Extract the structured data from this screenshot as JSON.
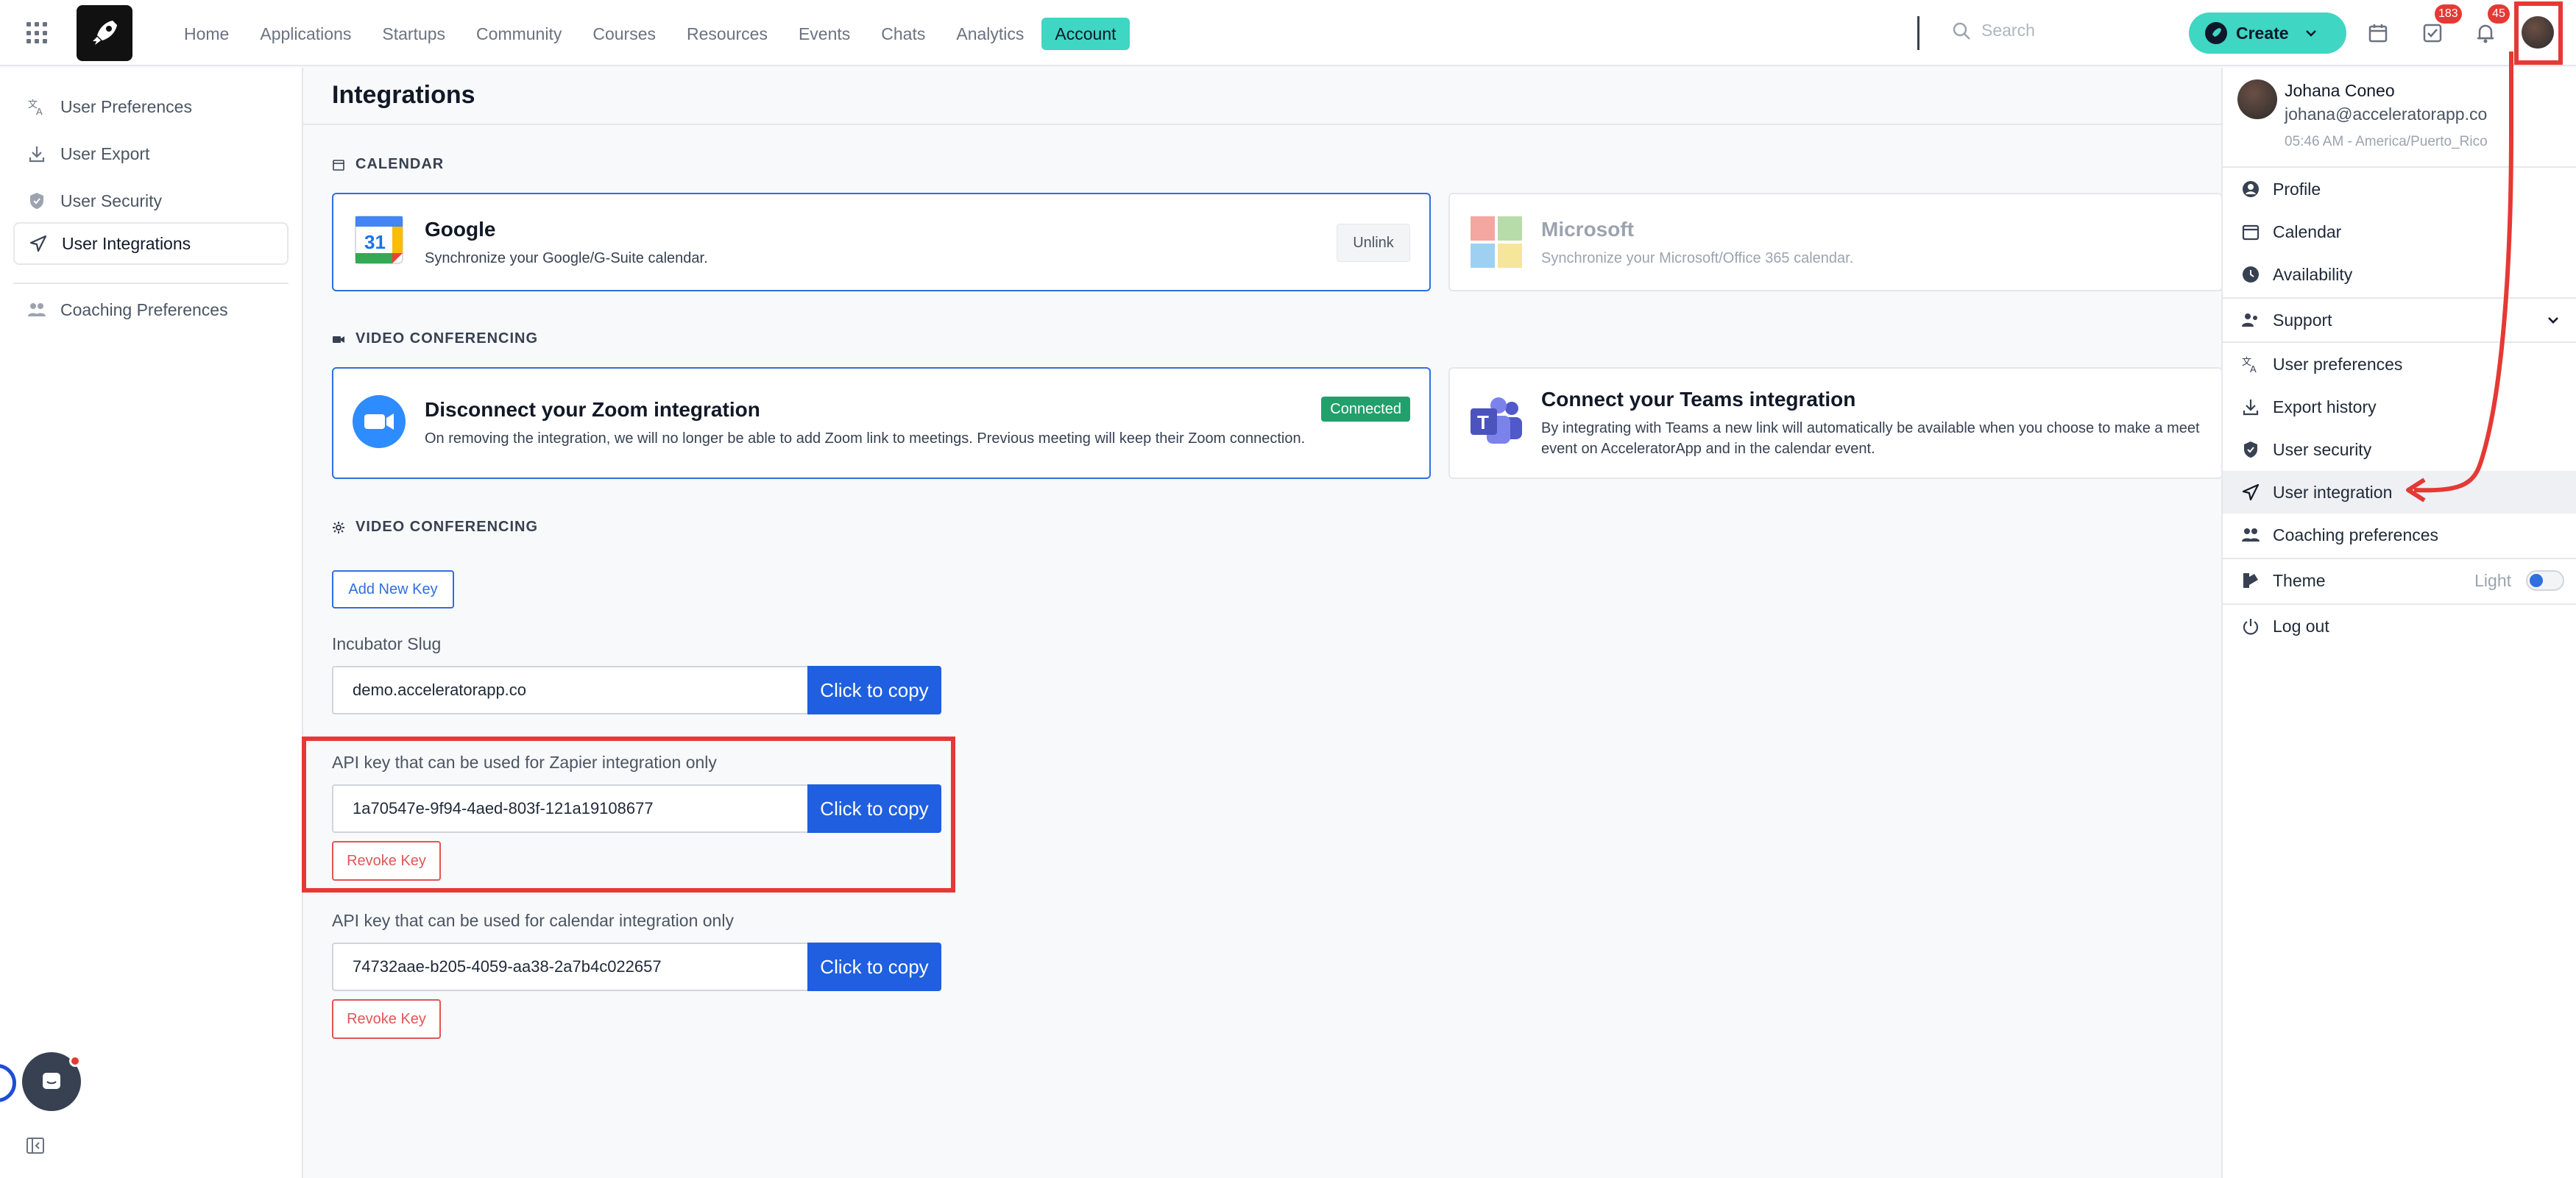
{
  "nav": {
    "items": [
      "Home",
      "Applications",
      "Startups",
      "Community",
      "Courses",
      "Resources",
      "Events",
      "Chats",
      "Analytics",
      "Account"
    ],
    "active": "Account",
    "search_placeholder": "Search",
    "create_label": "Create",
    "tasks_badge": "183",
    "notifications_badge": "45"
  },
  "sidebar": {
    "items": [
      {
        "label": "User Preferences",
        "icon": "translate-icon"
      },
      {
        "label": "User Export",
        "icon": "download-icon"
      },
      {
        "label": "User Security",
        "icon": "shield-icon"
      },
      {
        "label": "User Integrations",
        "icon": "send-icon"
      },
      {
        "label": "Coaching Preferences",
        "icon": "people-icon"
      }
    ]
  },
  "page": {
    "title": "Integrations",
    "calendar_section": "CALENDAR",
    "google": {
      "title": "Google",
      "desc": "Synchronize your Google/G-Suite calendar.",
      "action": "Unlink"
    },
    "microsoft": {
      "title": "Microsoft",
      "desc": "Synchronize your Microsoft/Office 365 calendar."
    },
    "video_section": "VIDEO CONFERENCING",
    "zoom": {
      "title": "Disconnect your Zoom integration",
      "desc": "On removing the integration, we will no longer be able to add Zoom link to meetings. Previous meeting will keep their Zoom connection.",
      "status": "Connected"
    },
    "teams": {
      "title": "Connect your Teams integration",
      "desc_line1": "By integrating with Teams a new link will automatically be available when you choose to make a meet",
      "desc_line2": "event on AcceleratorApp and in the calendar event."
    },
    "keys_section": "VIDEO CONFERENCING",
    "add_key": "Add New Key",
    "slug_label": "Incubator Slug",
    "slug_value": "demo.acceleratorapp.co",
    "copy_label": "Click to copy",
    "zapier_label": "API key that can be used for Zapier integration only",
    "zapier_key": "1a70547e-9f94-4aed-803f-121a19108677",
    "calendar_key_label": "API key that can be used for calendar integration only",
    "calendar_key": "74732aae-b205-4059-aa38-2a7b4c022657",
    "revoke_label": "Revoke Key"
  },
  "dropdown": {
    "name": "Johana Coneo",
    "email": "johana@acceleratorapp.co",
    "time": "05:46 AM - America/Puerto_Rico",
    "items_top": [
      {
        "label": "Profile",
        "icon": "user-circle-icon"
      },
      {
        "label": "Calendar",
        "icon": "calendar-icon"
      },
      {
        "label": "Availability",
        "icon": "clock-icon"
      }
    ],
    "support": "Support",
    "items_mid": [
      {
        "label": "User preferences",
        "icon": "translate-icon"
      },
      {
        "label": "Export history",
        "icon": "download-icon"
      },
      {
        "label": "User security",
        "icon": "shield-icon"
      },
      {
        "label": "User integration",
        "icon": "send-icon"
      },
      {
        "label": "Coaching preferences",
        "icon": "people-icon"
      }
    ],
    "theme": "Theme",
    "theme_value": "Light",
    "logout": "Log out"
  },
  "colors": {
    "accent": "#3fd6c3",
    "primary": "#1f5fe0",
    "danger": "#e05656",
    "highlight": "#e53935"
  }
}
